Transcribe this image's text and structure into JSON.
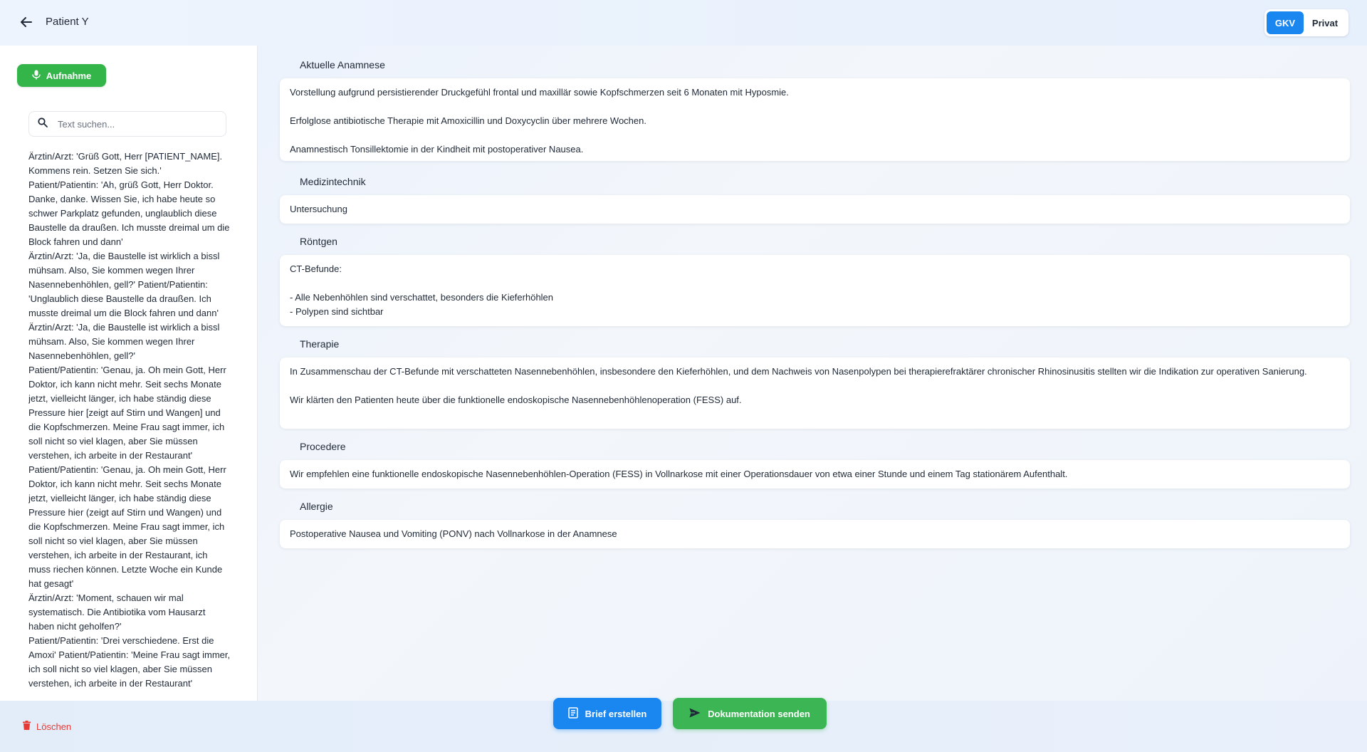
{
  "colors": {
    "accent_blue": "#1a86f0",
    "accent_green": "#34b54a",
    "danger_red": "#e53935"
  },
  "header": {
    "back_icon": "arrow-left-icon",
    "patient_name": "Patient Y",
    "insurance": {
      "options": [
        "GKV",
        "Privat"
      ],
      "selected": "GKV"
    }
  },
  "sidebar": {
    "record_button": {
      "icon": "microphone-icon",
      "label": "Aufnahme"
    },
    "search": {
      "icon": "search-icon",
      "placeholder": "Text suchen...",
      "value": ""
    },
    "transcript": [
      "Ärztin/Arzt: 'Grüß Gott, Herr [PATIENT_NAME]. Kommens rein. Setzen Sie sich.'",
      "Patient/Patientin: 'Ah, grüß Gott, Herr Doktor. Danke, danke. Wissen Sie, ich habe heute so schwer Parkplatz gefunden, unglaublich diese Baustelle da draußen. Ich musste dreimal um die Block fahren und dann'",
      "Ärztin/Arzt: 'Ja, die Baustelle ist wirklich a bissl mühsam. Also, Sie kommen wegen Ihrer Nasennebenhöhlen, gell?' Patient/Patientin: 'Unglaublich diese Baustelle da draußen. Ich musste dreimal um die Block fahren und dann'",
      "Ärztin/Arzt: 'Ja, die Baustelle ist wirklich a bissl mühsam. Also, Sie kommen wegen Ihrer Nasennebenhöhlen, gell?'",
      "Patient/Patientin: 'Genau, ja. Oh mein Gott, Herr Doktor, ich kann nicht mehr. Seit sechs Monate jetzt, vielleicht länger, ich habe ständig diese Pressure hier [zeigt auf Stirn und Wangen] und die Kopfschmerzen. Meine Frau sagt immer, ich soll nicht so viel klagen, aber Sie müssen verstehen, ich arbeite in der Restaurant' Patient/Patientin: 'Genau, ja. Oh mein Gott, Herr Doktor, ich kann nicht mehr. Seit sechs Monate jetzt, vielleicht länger, ich habe ständig diese Pressure hier (zeigt auf Stirn und Wangen) und die Kopfschmerzen. Meine Frau sagt immer, ich soll nicht so viel klagen, aber Sie müssen verstehen, ich arbeite in der Restaurant, ich muss riechen können. Letzte Woche ein Kunde hat gesagt'",
      "Ärztin/Arzt: 'Moment, schauen wir mal systematisch. Die Antibiotika vom Hausarzt haben nicht geholfen?'",
      "Patient/Patientin: 'Drei verschiedene. Erst die Amoxi' Patient/Patientin: 'Meine Frau sagt immer, ich soll nicht so viel klagen, aber Sie müssen verstehen, ich arbeite in der Restaurant'"
    ]
  },
  "sections": [
    {
      "title": "Aktuelle Anamnese",
      "lines": [
        "Vorstellung aufgrund persistierender Druckgefühl frontal und maxillär sowie Kopfschmerzen seit 6 Monaten mit Hyposmie.",
        "",
        "Erfolglose antibiotische Therapie mit Amoxicillin und Doxycyclin über mehrere Wochen.",
        "",
        "Anamnestisch Tonsillektomie in der Kindheit mit postoperativer Nausea."
      ]
    },
    {
      "title": "Medizintechnik",
      "lines": [
        "Untersuchung"
      ]
    },
    {
      "title": "Röntgen",
      "lines": [
        "CT-Befunde:",
        "",
        "- Alle Nebenhöhlen sind verschattet, besonders die Kieferhöhlen",
        "- Polypen sind sichtbar"
      ]
    },
    {
      "title": "Therapie",
      "lines": [
        "In Zusammenschau der CT-Befunde mit verschatteten Nasennebenhöhlen, insbesondere den Kieferhöhlen, und dem Nachweis von Nasenpolypen bei therapierefraktärer chronischer Rhinosinusitis stellten wir die Indikation zur operativen Sanierung.",
        "",
        "Wir klärten den Patienten heute über die funktionelle endoskopische Nasennebenhöhlenoperation (FESS) auf."
      ]
    },
    {
      "title": "Procedere",
      "lines": [
        "Wir empfehlen eine funktionelle endoskopische Nasennebenhöhlen-Operation (FESS) in Vollnarkose mit einer Operationsdauer von etwa einer Stunde und einem Tag stationärem Aufenthalt."
      ]
    },
    {
      "title": "Allergie",
      "lines": [
        "Postoperative Nausea und Vomiting (PONV) nach Vollnarkose in der Anamnese"
      ]
    }
  ],
  "footer": {
    "delete": {
      "icon": "trash-icon",
      "label": "Löschen"
    },
    "letter": {
      "icon": "document-icon",
      "label": "Brief erstellen"
    },
    "send": {
      "icon": "send-icon",
      "label": "Dokumentation senden"
    }
  }
}
